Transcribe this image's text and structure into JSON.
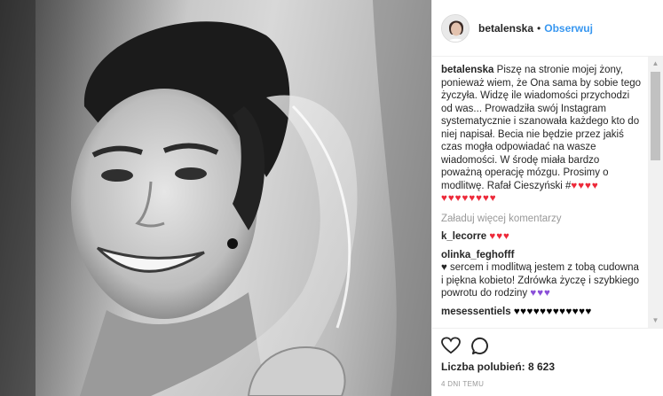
{
  "post": {
    "username": "betalenska",
    "separator": "•",
    "follow_label": "Obserwuj"
  },
  "caption": {
    "username": "betalenska",
    "text": "Piszę na stronie mojej żony, ponieważ wiem, że Ona sama by sobie tego życzyła. Widzę ile wiadomości przychodzi od was... Prowadziła swój Instagram systematycznie i szanowała każdego kto do niej napisał. Becia nie będzie przez jakiś czas mogła odpowiadać na wasze wiadomości. W środę miała bardzo poważną operację mózgu. Prosimy o modlitwę. Rafał Cieszyński #",
    "hearts_inline": "♥♥♥♥",
    "hearts_line": "♥♥♥♥♥♥♥♥"
  },
  "load_more_label": "Załaduj więcej komentarzy",
  "comments": [
    {
      "username": "k_lecorre",
      "text": "",
      "emoji": "♥♥♥",
      "emoji_color": "red"
    },
    {
      "username": "olinka_feghofff",
      "text": "♥ sercem i modlitwą jestem z tobą cudowna i piękna kobieto! Zdrówka życzę i szybkiego powrotu do rodziny",
      "emoji": "♥♥♥",
      "emoji_color": "purple"
    },
    {
      "username": "mesessentiels",
      "text": "",
      "emoji": "♥♥♥♥♥♥♥♥♥♥♥♥",
      "emoji_color": "black"
    }
  ],
  "likes_label": "Liczba polubień: 8 623",
  "timestamp": "4 DNI TEMU",
  "icons": {
    "like": "heart-outline-icon",
    "comment": "speech-bubble-icon",
    "scroll_up": "▲",
    "scroll_down": "▼"
  },
  "colors": {
    "follow": "#3897f0",
    "heart": "#ed2939",
    "purple_heart": "#8a4fd8"
  }
}
